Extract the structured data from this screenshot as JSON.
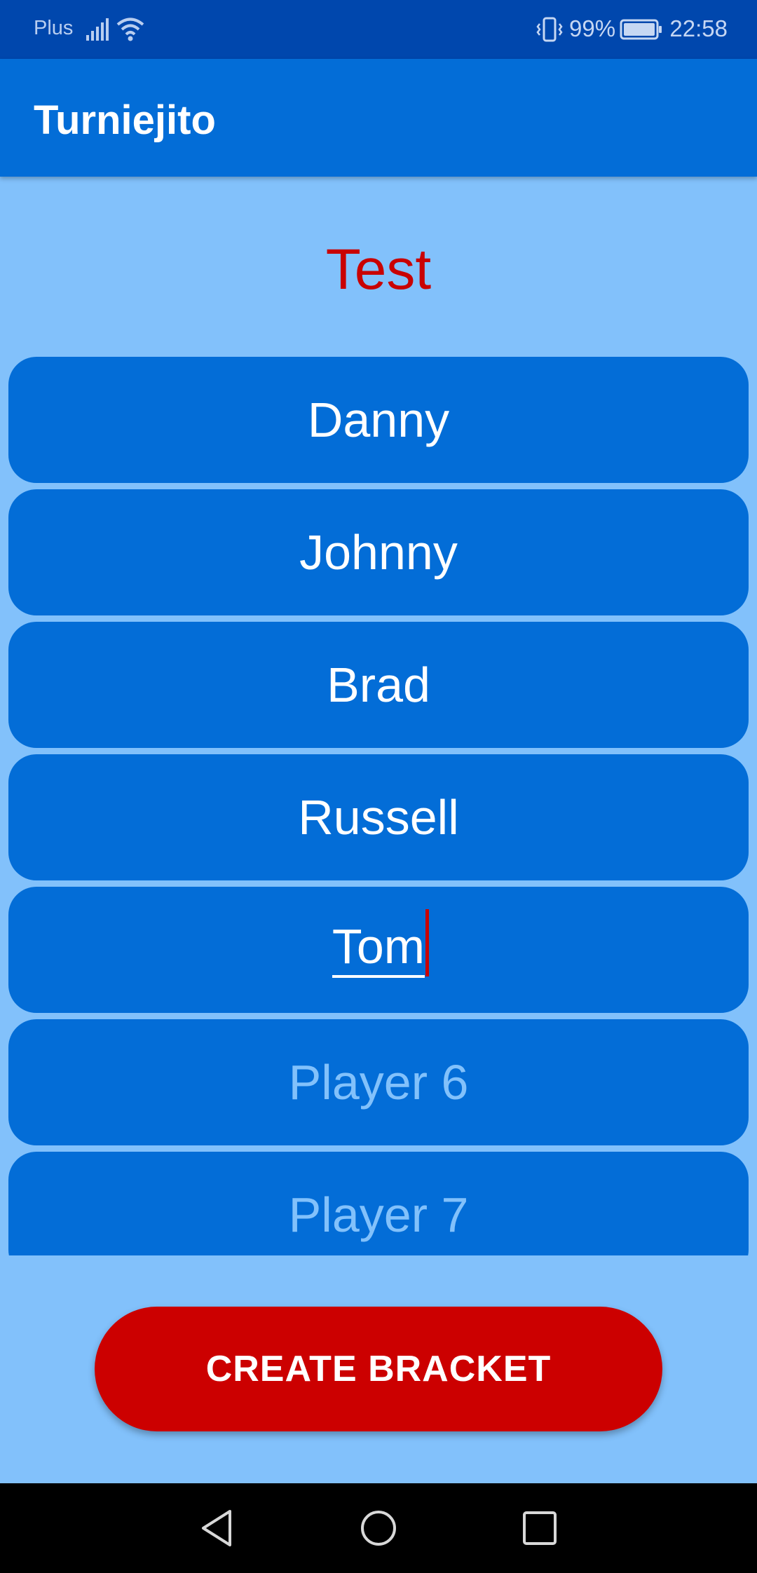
{
  "status_bar": {
    "carrier": "Plus",
    "battery_percent": "99%",
    "time": "22:58",
    "icons": [
      "signal-icon",
      "wifi-icon",
      "vibrate-icon",
      "battery-icon"
    ]
  },
  "app_bar": {
    "title": "Turniejito"
  },
  "tournament": {
    "name": "Test"
  },
  "players": [
    {
      "value": "Danny",
      "placeholder": ""
    },
    {
      "value": "Johnny",
      "placeholder": ""
    },
    {
      "value": "Brad",
      "placeholder": ""
    },
    {
      "value": "Russell",
      "placeholder": ""
    },
    {
      "value": "Tom",
      "placeholder": ""
    },
    {
      "value": "",
      "placeholder": "Player 6"
    },
    {
      "value": "",
      "placeholder": "Player 7"
    }
  ],
  "actions": {
    "create_bracket_label": "CREATE BRACKET"
  },
  "nav_bar": {
    "icons": [
      "back-icon",
      "home-icon",
      "recents-icon"
    ]
  },
  "colors": {
    "status_bar": "#0047ad",
    "app_bar": "#036dd7",
    "background": "#82c1fb",
    "accent_red": "#cc0000",
    "title_red": "#c90202"
  }
}
